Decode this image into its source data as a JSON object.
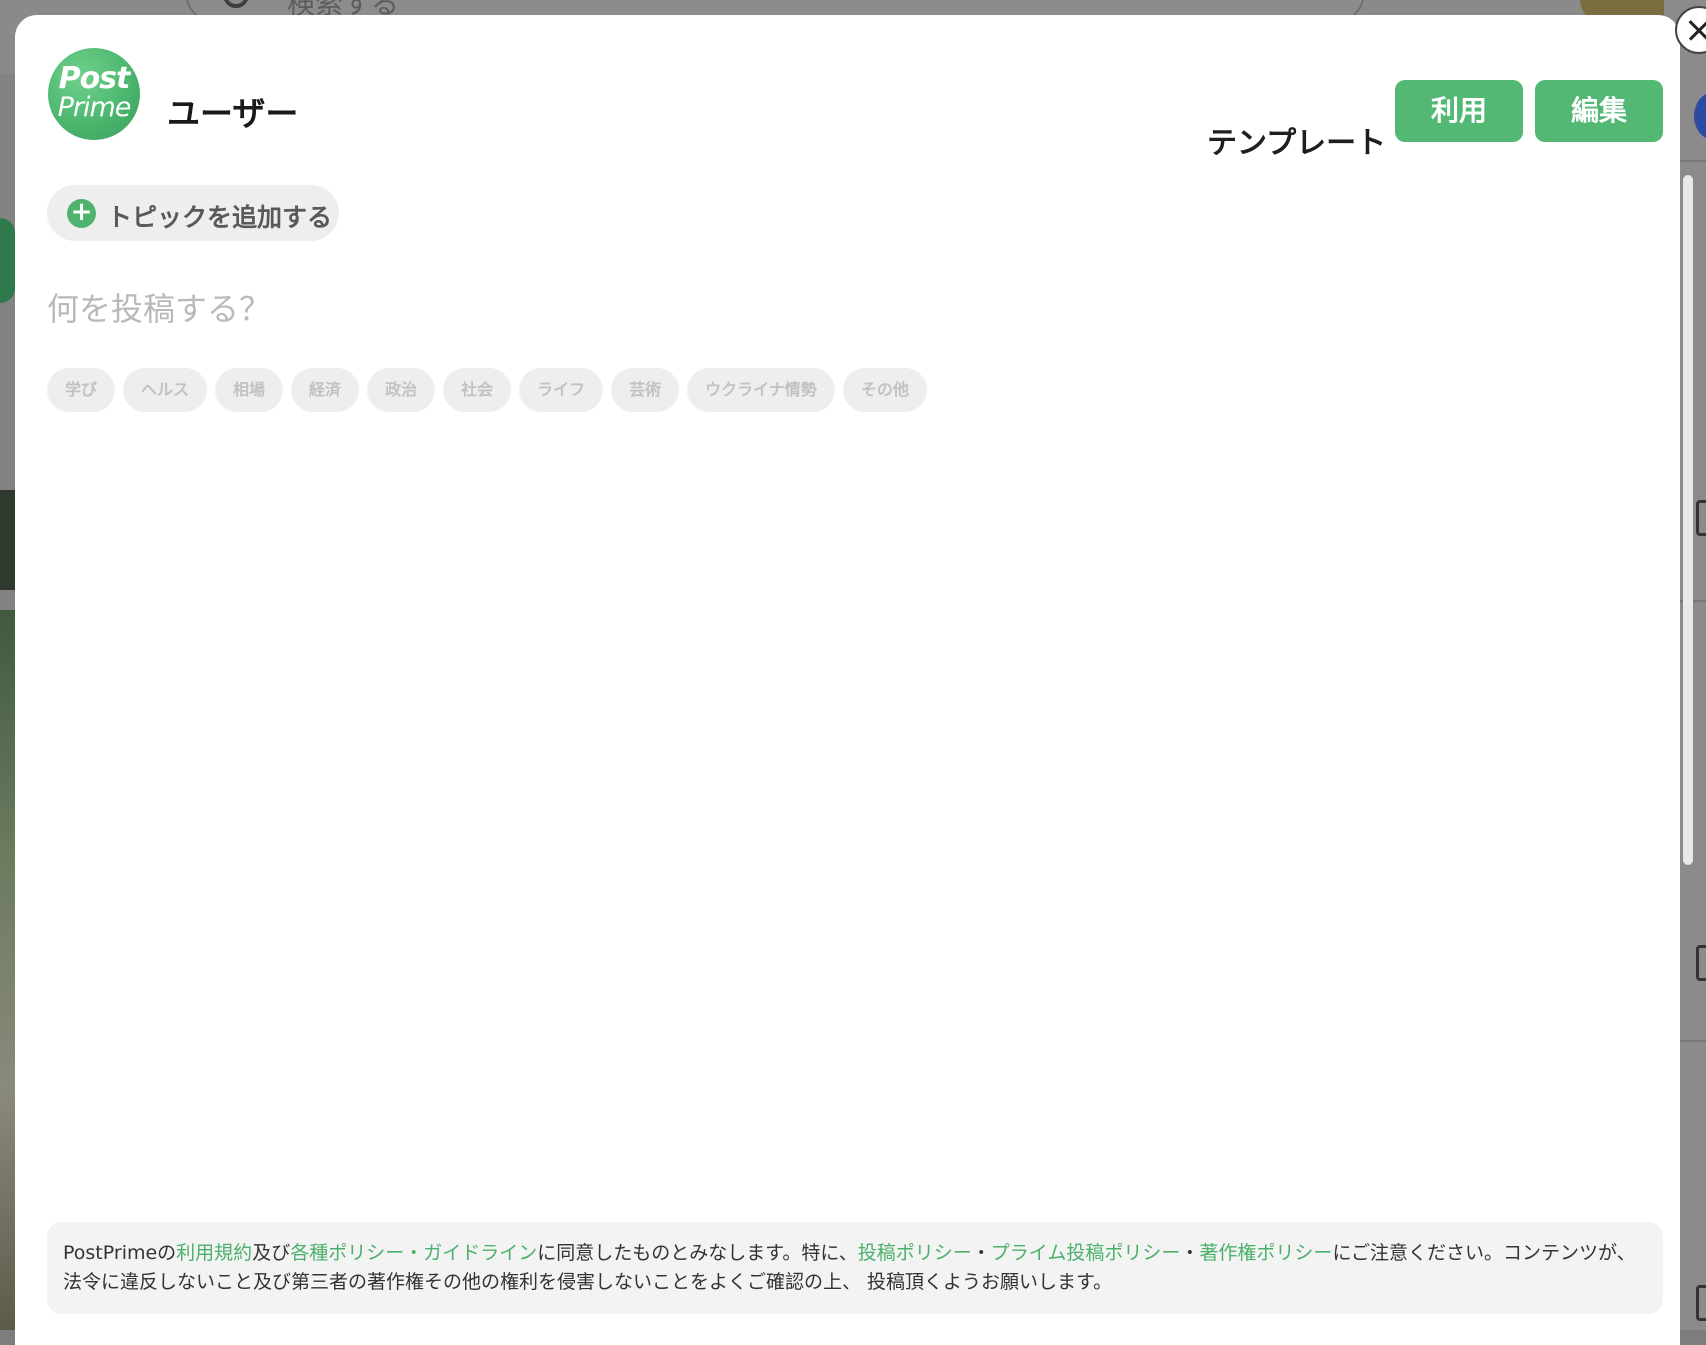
{
  "background": {
    "search_placeholder": "検索する"
  },
  "modal": {
    "avatar": {
      "line1": "Post",
      "line2": "Prime"
    },
    "username": "ユーザー",
    "template_label": "テンプレート",
    "use_button": "利用",
    "edit_button": "編集",
    "add_topic_label": "トピックを追加する",
    "post_placeholder": "何を投稿する？",
    "categories": [
      "学び",
      "ヘルス",
      "相場",
      "経済",
      "政治",
      "社会",
      "ライフ",
      "芸術",
      "ウクライナ情勢",
      "その他"
    ],
    "notice": {
      "t1": "PostPrimeの",
      "link_terms": "利用規約",
      "t2": "及び",
      "link_policies": "各種ポリシー・ガイドライン",
      "t3": "に同意したものとみなします。特に、",
      "link_post_policy": "投稿ポリシー",
      "sep1": "・",
      "link_prime_policy": "プライム投稿ポリシー",
      "sep2": "・",
      "link_copyright": "著作権ポリシー",
      "t4": "にご注意ください。コンテンツが、法令に違反しないこと及び第三者の著作権その他の権利を侵害しないことをよくご確認の上、 投稿頂くようお願いします。"
    }
  },
  "colors": {
    "accent_green": "#52b874",
    "link_green": "#4bb06b",
    "overlay": "#7d7d7d"
  },
  "icons": [
    "close-icon",
    "plus-icon",
    "search-icon"
  ]
}
